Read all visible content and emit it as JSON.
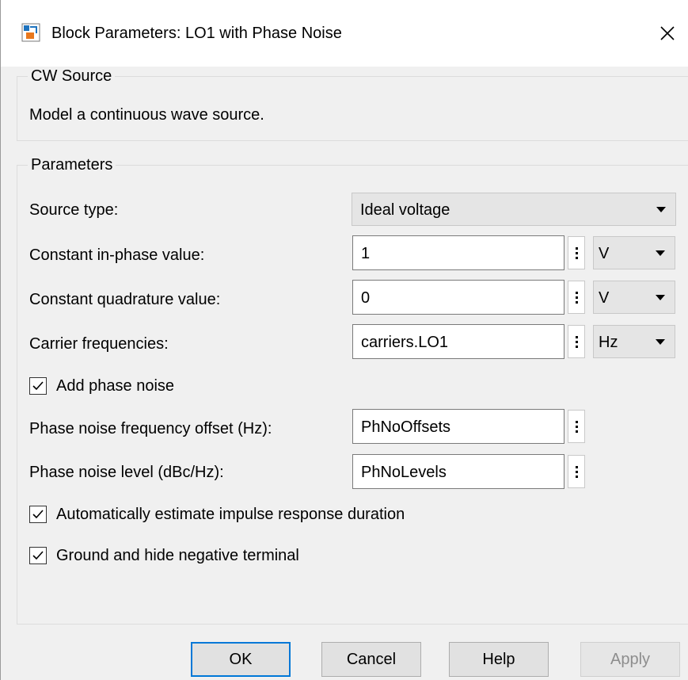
{
  "window": {
    "title": "Block Parameters: LO1 with Phase Noise"
  },
  "block": {
    "name": "CW Source",
    "description": "Model a continuous wave source."
  },
  "parameters": {
    "legend": "Parameters",
    "source_type": {
      "label": "Source type:",
      "value": "Ideal voltage"
    },
    "inphase": {
      "label": "Constant in-phase value:",
      "value": "1",
      "unit": "V"
    },
    "quadrature": {
      "label": "Constant quadrature value:",
      "value": "0",
      "unit": "V"
    },
    "carrier": {
      "label": "Carrier frequencies:",
      "value": "carriers.LO1",
      "unit": "Hz"
    },
    "add_phase_noise": {
      "label": "Add phase noise",
      "checked": true
    },
    "pn_offset": {
      "label": "Phase noise frequency offset (Hz):",
      "value": "PhNoOffsets"
    },
    "pn_level": {
      "label": "Phase noise level (dBc/Hz):",
      "value": "PhNoLevels"
    },
    "auto_estimate": {
      "label": "Automatically estimate impulse response duration",
      "checked": true
    },
    "ground_hide": {
      "label": "Ground and hide negative terminal",
      "checked": true
    }
  },
  "buttons": {
    "ok": "OK",
    "cancel": "Cancel",
    "help": "Help",
    "apply": "Apply"
  },
  "colors": {
    "accent": "#0078d7",
    "disabled_text": "#8d8d8d",
    "icon_blue": "#1e73be",
    "icon_orange": "#e8781e"
  }
}
